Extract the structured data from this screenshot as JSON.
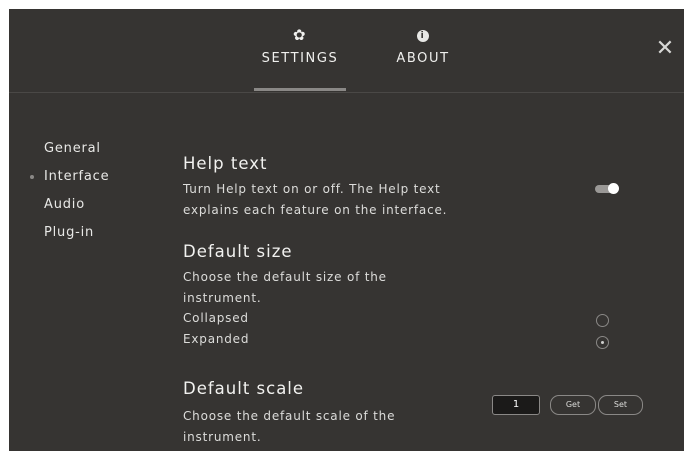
{
  "tabs": [
    {
      "label": "SETTINGS",
      "icon": "gear-icon",
      "active": true
    },
    {
      "label": "ABOUT",
      "icon": "info-icon",
      "active": false
    }
  ],
  "close_icon": "close-icon",
  "sidebar": {
    "items": [
      {
        "label": "General",
        "selected": false
      },
      {
        "label": "Interface",
        "selected": true
      },
      {
        "label": "Audio",
        "selected": false
      },
      {
        "label": "Plug-in",
        "selected": false
      }
    ]
  },
  "help_text": {
    "title": "Help text",
    "description_line1": "Turn Help text on or off. The Help text",
    "description_line2": "explains each feature on the interface.",
    "toggle_on": true
  },
  "default_size": {
    "title": "Default size",
    "description_line1": "Choose the default size of the",
    "description_line2": "instrument.",
    "options": [
      {
        "label": "Collapsed",
        "selected": false
      },
      {
        "label": "Expanded",
        "selected": true
      }
    ]
  },
  "default_scale": {
    "title": "Default scale",
    "description_line1": "Choose the default scale of the",
    "description_line2": "instrument.",
    "value": "1",
    "get_label": "Get",
    "set_label": "Set"
  },
  "colors": {
    "background": "#363432",
    "text": "#e6e6e4",
    "accent": "#8a8886"
  }
}
